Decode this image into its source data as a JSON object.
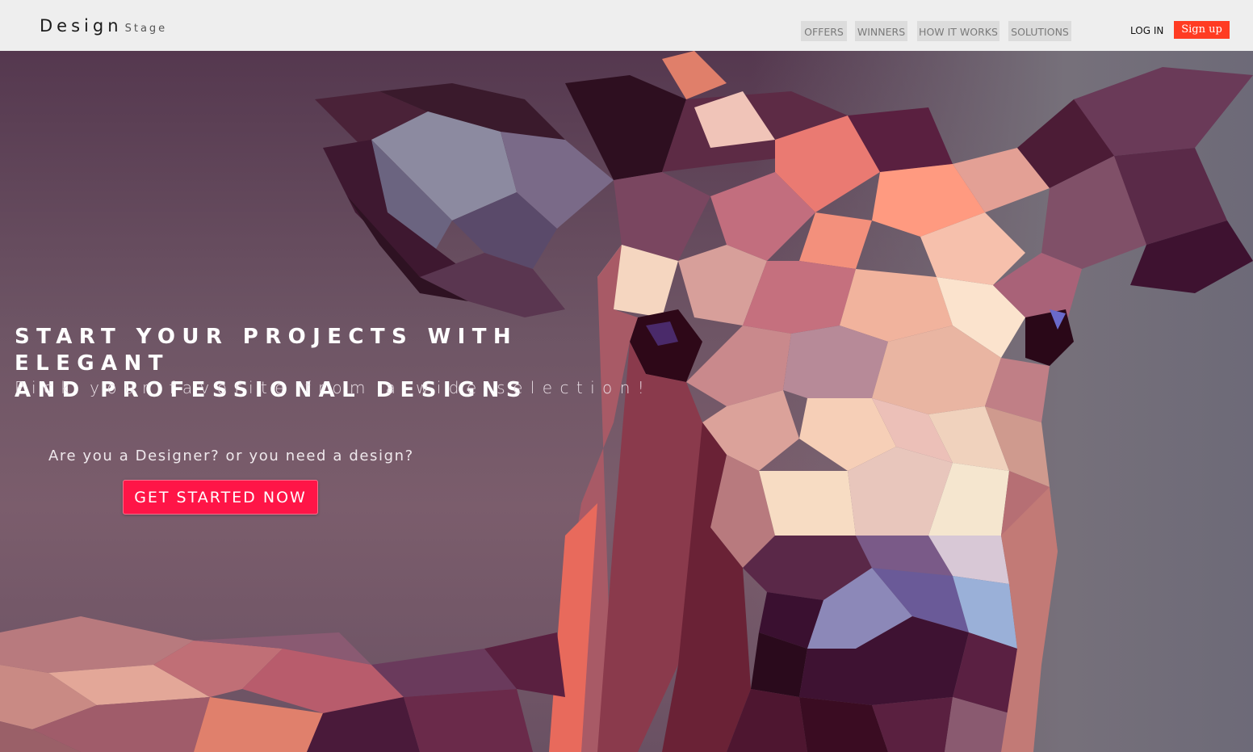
{
  "brand": {
    "main": "Design",
    "sub": "Stage"
  },
  "nav": {
    "items": [
      {
        "label": "OFFERS"
      },
      {
        "label": "WINNERS"
      },
      {
        "label": "HOW IT WORKS"
      },
      {
        "label": "SOLUTIONS"
      }
    ],
    "login_label": "LOG IN",
    "signup_label": "Sign up"
  },
  "hero": {
    "title_line1": "START YOUR PROJECTS WITH ELEGANT",
    "title_line2": "AND PROFESSIONAL DESIGNS",
    "subtitle": "Pick your favorite from a wide selection!",
    "question": "Are you a Designer? or you need a design?",
    "cta_label": "GET STARTED NOW"
  },
  "colors": {
    "header_bg": "#eeeeee",
    "signup_bg": "#ff3b22",
    "cta_bg": "#ff1547"
  }
}
